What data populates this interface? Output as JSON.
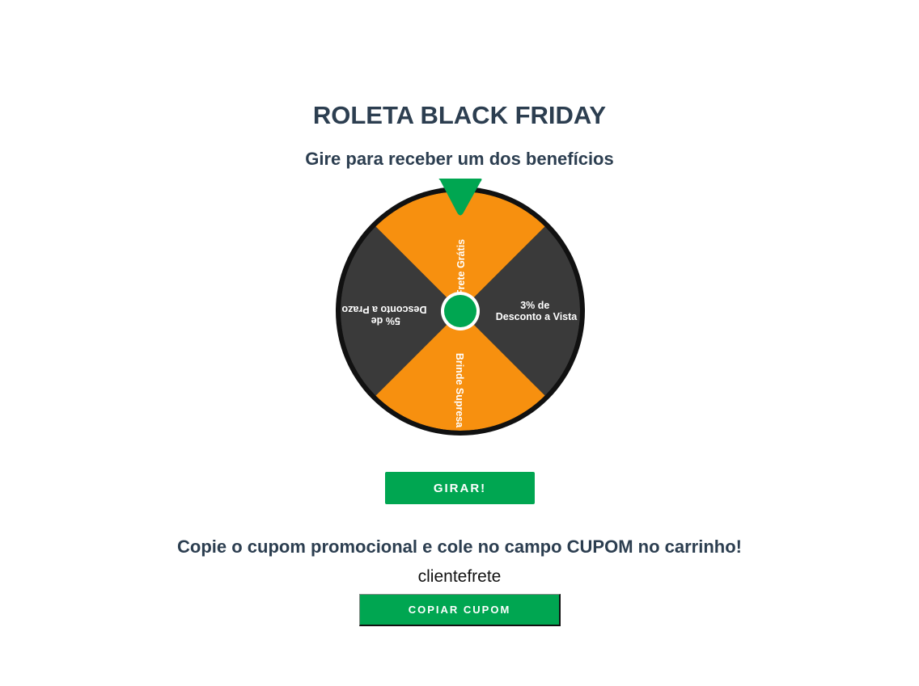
{
  "header": {
    "title": "ROLETA BLACK FRIDAY",
    "subtitle": "Gire para receber um dos benefícios"
  },
  "wheel": {
    "segments": [
      {
        "label_lines": [
          "Frete Grátis"
        ],
        "color": "#f7900f"
      },
      {
        "label_lines": [
          "3% de",
          "Desconto a Vista"
        ],
        "color": "#3a3a3a"
      },
      {
        "label_lines": [
          "Brinde Supresa"
        ],
        "color": "#f7900f"
      },
      {
        "label_lines": [
          "5% de",
          "Desconto a Prazo"
        ],
        "color": "#3a3a3a"
      }
    ],
    "rim_color": "#111111",
    "hub_color": "#00a651",
    "pointer_color": "#00a651"
  },
  "spin_button": {
    "label": "GIRAR!"
  },
  "coupon": {
    "instruction": "Copie o cupom promocional e cole no campo CUPOM no carrinho!",
    "code": "clientefrete",
    "copy_label": "COPIAR CUPOM"
  },
  "colors": {
    "accent": "#00a651",
    "heading": "#2c3e50",
    "orange": "#f7900f",
    "dark": "#3a3a3a"
  }
}
